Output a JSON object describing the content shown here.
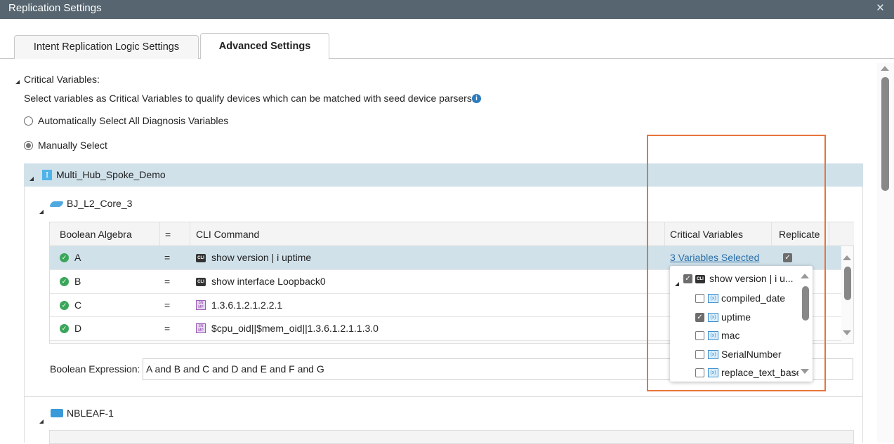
{
  "window": {
    "title": "Replication Settings",
    "close_icon": "×"
  },
  "tabs": [
    {
      "label": "Intent Replication Logic Settings"
    },
    {
      "label": "Advanced Settings",
      "active": true
    }
  ],
  "critical": {
    "heading": "Critical Variables:",
    "description": "Select variables as Critical Variables to qualify devices which can be matched with seed device parsers:",
    "options": [
      {
        "label": "Automatically Select All Diagnosis Variables",
        "selected": false
      },
      {
        "label": "Manually Select",
        "selected": true
      }
    ]
  },
  "group": {
    "name": "Multi_Hub_Spoke_Demo",
    "icon_letter": "I"
  },
  "devices": [
    {
      "name": "BJ_L2_Core_3",
      "table": {
        "headers": [
          "Boolean Algebra",
          "=",
          "CLI Command",
          "Critical Variables",
          "Replicate"
        ],
        "rows": [
          {
            "var": "A",
            "eq": "=",
            "type": "CLI",
            "command": "show version | i uptime",
            "critical": "3 Variables Selected",
            "replicate": true
          },
          {
            "var": "B",
            "eq": "=",
            "type": "CLI",
            "command": "show interface Loopback0",
            "critical": "",
            "replicate": null
          },
          {
            "var": "C",
            "eq": "=",
            "type": "SNMP",
            "command": "1.3.6.1.2.1.2.2.1",
            "critical": "",
            "replicate": null
          },
          {
            "var": "D",
            "eq": "=",
            "type": "SNMP",
            "command": "$cpu_oid||$mem_oid||1.3.6.1.2.1.1.3.0",
            "critical": "",
            "replicate": null
          }
        ]
      },
      "boolean_label": "Boolean Expression:",
      "boolean_value": "A and B and C and D and E and F and G"
    },
    {
      "name": "NBLEAF-1"
    }
  ],
  "popup": {
    "parent": "show version | i u...",
    "items": [
      {
        "label": "compiled_date",
        "checked": false
      },
      {
        "label": "uptime",
        "checked": true
      },
      {
        "label": "mac",
        "checked": false
      },
      {
        "label": "SerialNumber",
        "checked": false
      },
      {
        "label": "replace_text_base",
        "checked": false
      }
    ]
  },
  "colors": {
    "highlight": "#e8743b",
    "selected_row": "#d0e1ea",
    "titlebar": "#56656f"
  }
}
